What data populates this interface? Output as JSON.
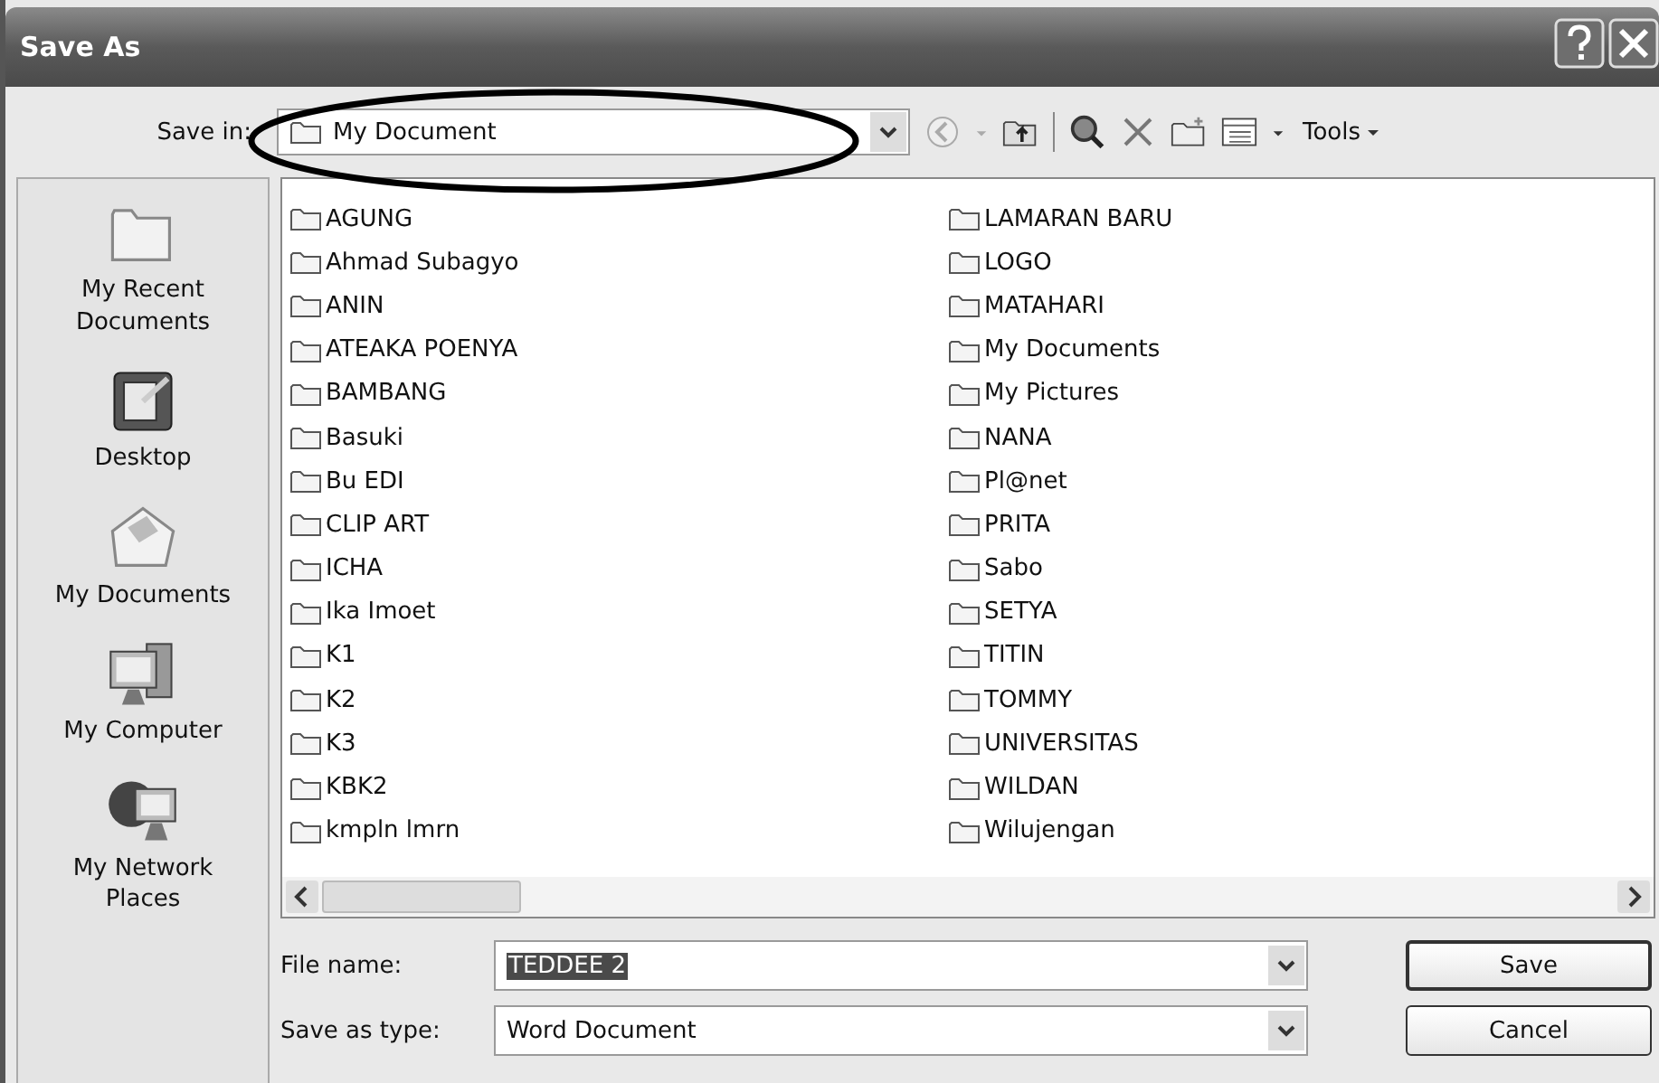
{
  "window": {
    "title": "Save As"
  },
  "save_in": {
    "label": "Save in:",
    "value": "My Document"
  },
  "toolbar": {
    "tools_label": "Tools"
  },
  "places": [
    {
      "label": "My Recent Documents",
      "kind": "recent"
    },
    {
      "label": "Desktop",
      "kind": "desktop"
    },
    {
      "label": "My Documents",
      "kind": "documents"
    },
    {
      "label": "My Computer",
      "kind": "computer"
    },
    {
      "label": "My Network Places",
      "kind": "network"
    }
  ],
  "files": [
    "AGUNG",
    "Ahmad Subagyo",
    "ANIN",
    "ATEAKA POENYA",
    "BAMBANG",
    "Basuki",
    "Bu EDI",
    "CLIP ART",
    "ICHA",
    "Ika Imoet",
    "K1",
    "K2",
    "K3",
    "KBK2",
    "kmpln lmrn",
    "LAMARAN BARU",
    "LOGO",
    "MATAHARI",
    "My Documents",
    "My Pictures",
    "NANA",
    "Pl@net",
    "PRITA",
    "Sabo",
    "SETYA",
    "TITIN",
    "TOMMY",
    "UNIVERSITAS",
    "WILDAN",
    "Wilujengan"
  ],
  "file_name": {
    "label": "File name:",
    "value": "TEDDEE 2",
    "selected": true
  },
  "save_as_type": {
    "label": "Save as type:",
    "value": "Word Document"
  },
  "buttons": [
    {
      "label": "Save",
      "default": true
    },
    {
      "label": "Cancel",
      "default": false
    }
  ]
}
